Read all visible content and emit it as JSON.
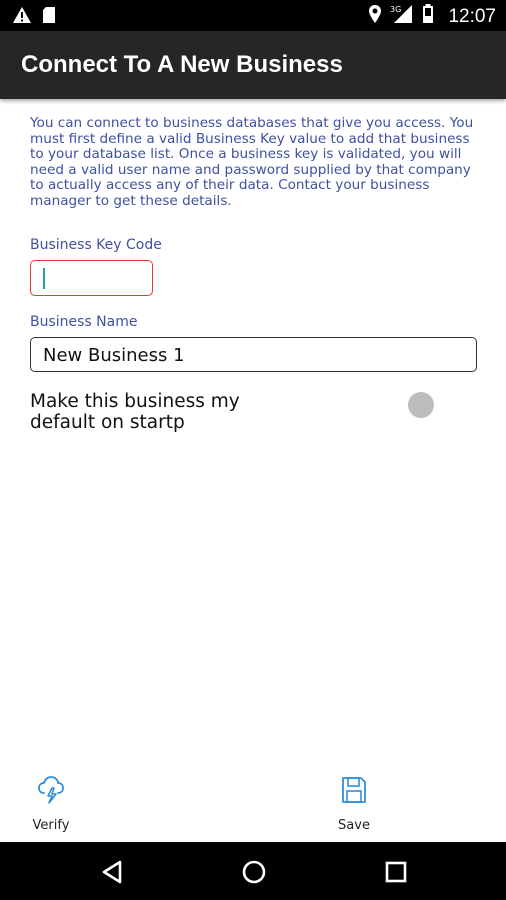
{
  "status_bar": {
    "time": "12:07",
    "network": "3G",
    "icons": [
      "warning-icon",
      "sd-card-icon",
      "location-icon",
      "signal-icon",
      "battery-icon"
    ]
  },
  "app_bar": {
    "title": "Connect To A New Business"
  },
  "intro_text": "You can connect to business databases that give you access. You must first define a valid Business Key value to add that business to your database list. Once a business key is validated, you will need a valid user name and password supplied by that company to actually access any of their data. Contact your business manager to get these details.",
  "business_key": {
    "label": "Business Key Code",
    "value": ""
  },
  "business_name": {
    "label": "Business Name",
    "value": "New Business 1"
  },
  "default_toggle": {
    "label": "Make this business my default on startp",
    "checked": false
  },
  "actions": {
    "verify": {
      "label": "Verify",
      "icon": "cloud-lightning-icon"
    },
    "save": {
      "label": "Save",
      "icon": "save-icon"
    }
  },
  "nav": {
    "icons": [
      "back-icon",
      "home-icon",
      "recent-apps-icon"
    ]
  },
  "colors": {
    "accent_blue": "#3f51a0",
    "icon_blue": "#2f8fd8",
    "error_red": "#e53935",
    "app_bar": "#262626"
  }
}
